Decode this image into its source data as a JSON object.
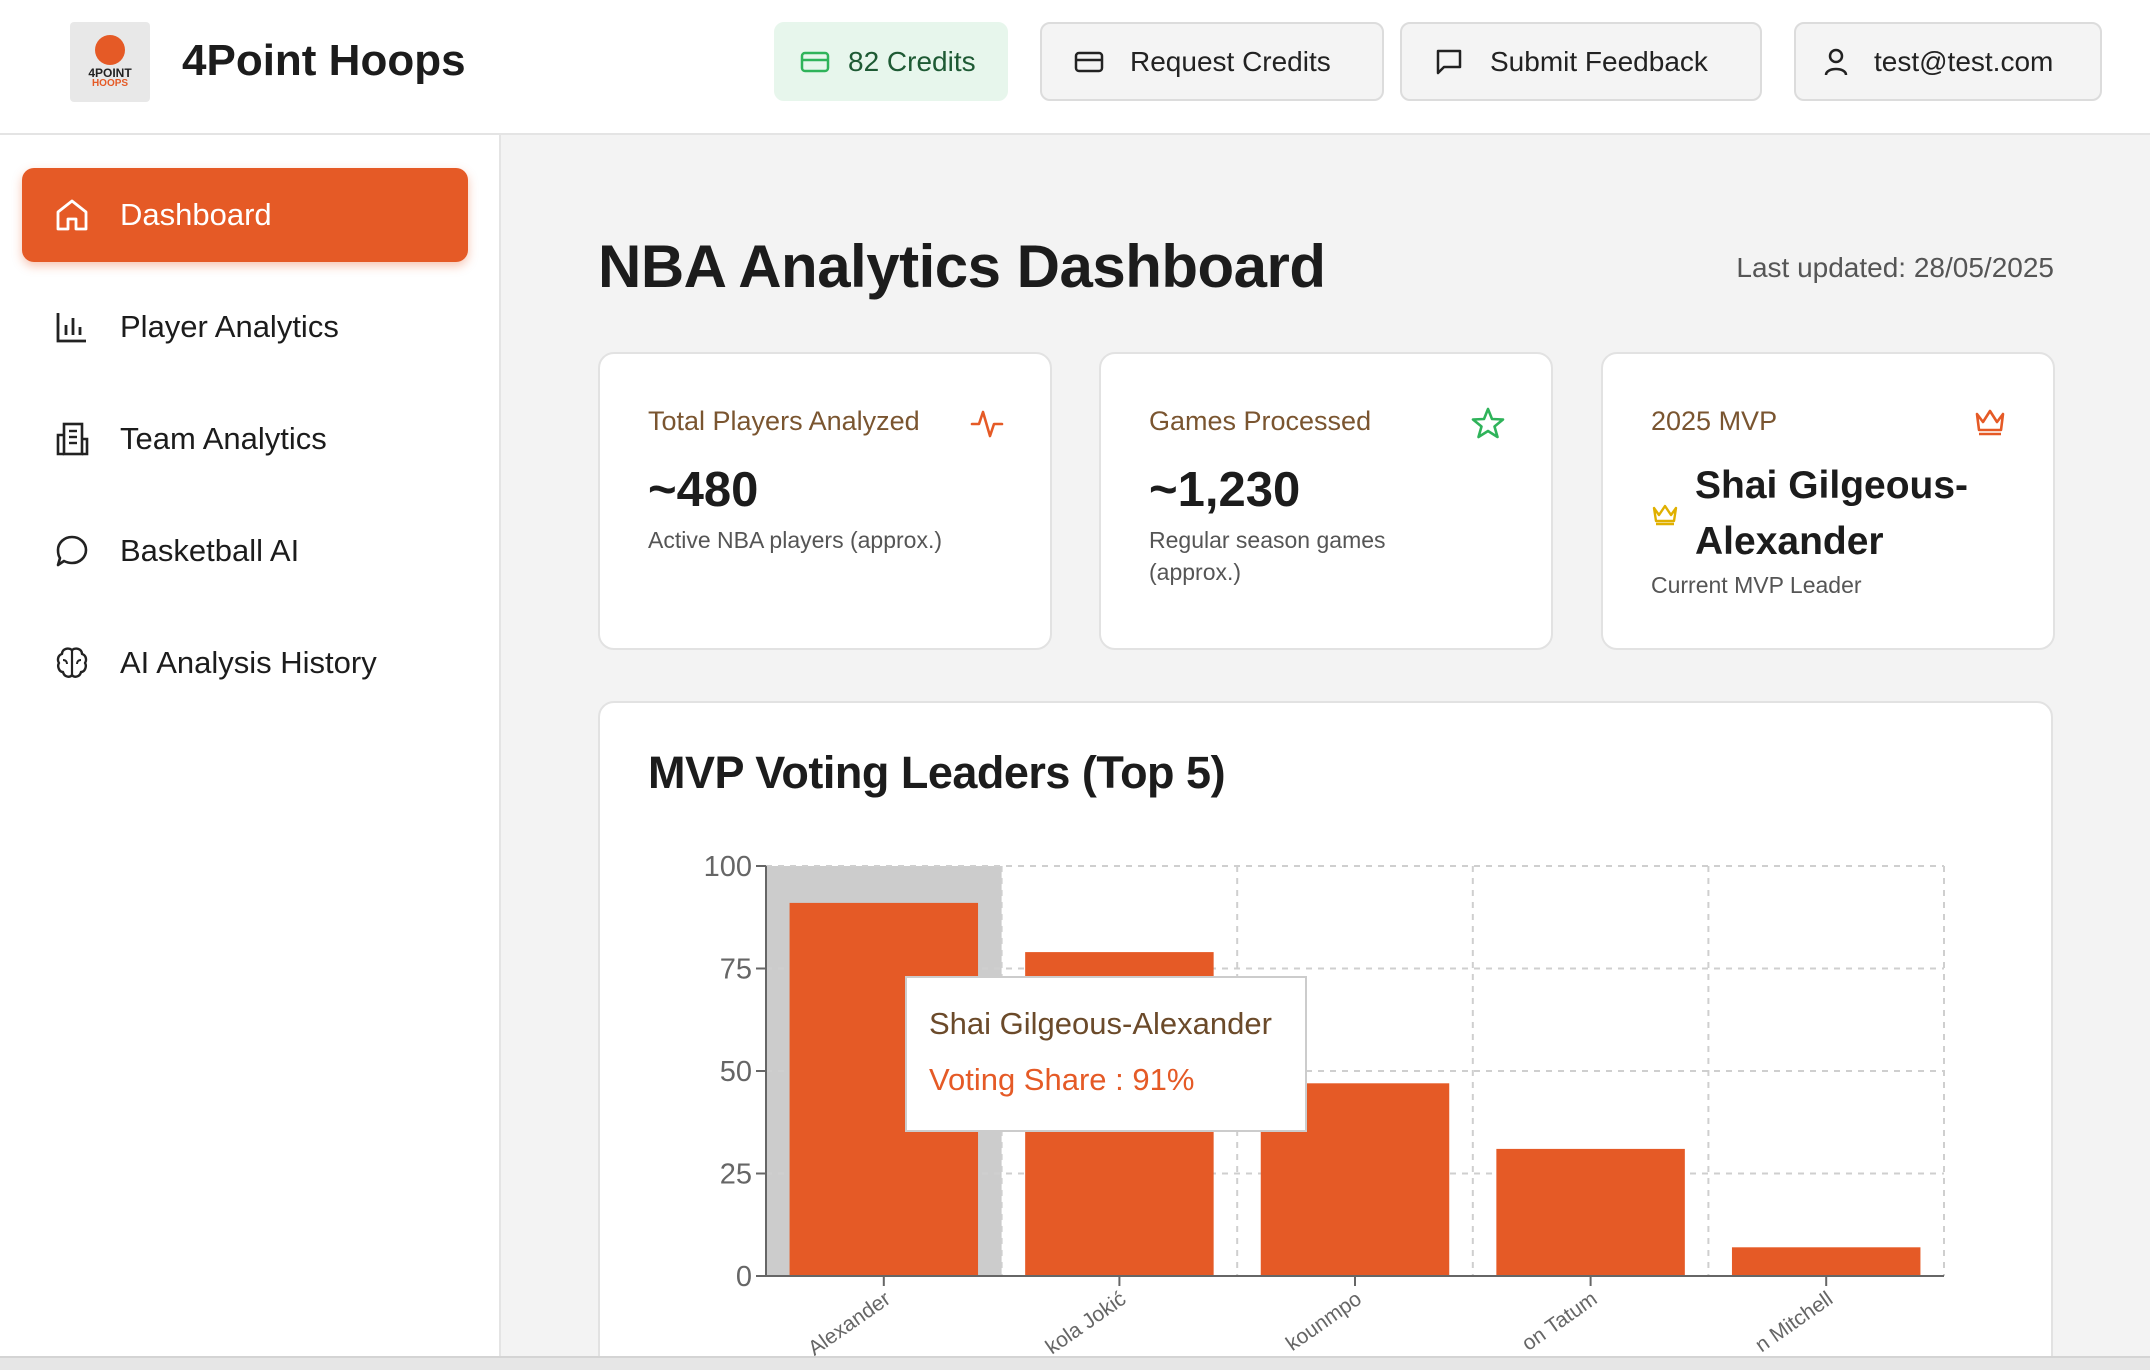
{
  "app": {
    "title": "4Point Hoops",
    "logo_text_1": "4POINT",
    "logo_text_2": "HOOPS"
  },
  "header": {
    "credits_label": "82 Credits",
    "request_credits_label": "Request Credits",
    "submit_feedback_label": "Submit Feedback",
    "user_email": "test@test.com",
    "icons": {
      "credits": "credit-card-icon",
      "request": "credit-card-icon",
      "feedback": "message-square-icon",
      "user": "user-icon"
    }
  },
  "sidebar": {
    "items": [
      {
        "label": "Dashboard",
        "icon": "home-icon",
        "active": true
      },
      {
        "label": "Player Analytics",
        "icon": "bar-chart-icon",
        "active": false
      },
      {
        "label": "Team Analytics",
        "icon": "building-icon",
        "active": false
      },
      {
        "label": "Basketball AI",
        "icon": "message-circle-icon",
        "active": false
      },
      {
        "label": "AI Analysis History",
        "icon": "brain-icon",
        "active": false
      }
    ]
  },
  "main": {
    "title": "NBA Analytics Dashboard",
    "last_updated": "Last updated: 28/05/2025",
    "cards": [
      {
        "label": "Total Players Analyzed",
        "value": "~480",
        "desc": "Active NBA players (approx.)",
        "icon": "activity-icon"
      },
      {
        "label": "Games Processed",
        "value": "~1,230",
        "desc": "Regular season games (approx.)",
        "icon": "star-icon"
      },
      {
        "label": "2025 MVP",
        "value": "Shai Gilgeous-Alexander",
        "desc": "Current MVP Leader",
        "icon": "crown-icon"
      }
    ],
    "chart_title": "MVP Voting Leaders (Top 5)",
    "tooltip": {
      "name": "Shai Gilgeous-Alexander",
      "value": "Voting Share : 91%"
    }
  },
  "colors": {
    "accent": "#e55a26",
    "credits_bg": "#e7f6ec",
    "credits_text": "#1e5a34",
    "star_green": "#2fb35a",
    "crown_gold": "#e0b000"
  },
  "chart_data": {
    "type": "bar",
    "categories": [
      "Shai Gilgeous-Alexander",
      "Nikola Jokić",
      "Giannis Antetokounmpo",
      "Jayson Tatum",
      "Donovan Mitchell"
    ],
    "category_labels_visible": [
      "Alexander",
      "kola Jokić",
      "kounmpo",
      "on Tatum",
      "n Mitchell"
    ],
    "series": [
      {
        "values": [
          91,
          79,
          47,
          31,
          7
        ]
      }
    ],
    "ylim": [
      0,
      100
    ],
    "yticks": [
      0,
      25,
      50,
      75,
      100
    ],
    "grid": true,
    "highlighted_index": 0
  }
}
